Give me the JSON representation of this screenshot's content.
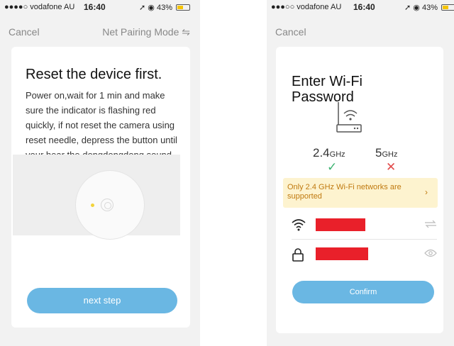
{
  "left": {
    "status": {
      "carrier": "●●●●○ vodafone AU",
      "time": "16:40",
      "battery": "43%"
    },
    "nav": {
      "cancel": "Cancel",
      "mode": "Net Pairing Mode ⇋"
    },
    "title": "Reset the device first.",
    "body": "Power on,wait for 1 min and make sure the indicator is flashing red quickly, if not reset the camera using reset needle, depress the button until your hear the dongdongdong sound, then let go of the pin",
    "next_button": "next step"
  },
  "right": {
    "status": {
      "carrier": "●●●○○ vodafone AU",
      "time": "16:40",
      "battery": "43%"
    },
    "nav": {
      "cancel": "Cancel"
    },
    "title": "Enter Wi-Fi Password",
    "freq_24": {
      "value": "2.4",
      "unit": "GHz",
      "mark": "✓"
    },
    "freq_5": {
      "value": "5",
      "unit": "GHz",
      "mark": "✕"
    },
    "warning": "Only 2.4 GHz Wi-Fi networks are supported",
    "warning_chevron": "›",
    "confirm_button": "Confirm"
  },
  "colors": {
    "accent": "#6ab7e3",
    "ok": "#3cb371",
    "error": "#e24b4b",
    "warning_bg": "#fdf3cf",
    "redaction": "#e9202a"
  },
  "icons": [
    "wifi-icon",
    "lock-icon",
    "swap-icon",
    "eye-icon",
    "router-icon",
    "location-icon",
    "alarm-icon"
  ]
}
